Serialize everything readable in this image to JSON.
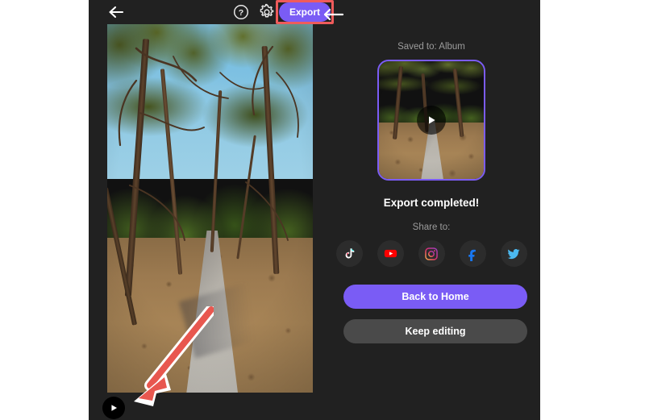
{
  "app": {
    "background_color": "#212121",
    "accent_color": "#7a5cf5",
    "highlight_color": "#ef5b5b"
  },
  "topbar": {
    "back_icon": "arrow-left-icon",
    "help_icon": "question-circle-icon",
    "settings_icon": "gear-icon",
    "export_label": "Export"
  },
  "preview": {
    "play_icon": "play-icon"
  },
  "right_panel": {
    "saved_to_label": "Saved to: Album",
    "thumbnail_play_icon": "play-icon",
    "export_completed_label": "Export completed!",
    "share_to_label": "Share to:",
    "social": [
      {
        "name": "tiktok",
        "label": "TikTok",
        "color": "#ffffff"
      },
      {
        "name": "youtube",
        "label": "YouTube",
        "color": "#ff0000"
      },
      {
        "name": "instagram",
        "label": "Instagram",
        "color": "#e1306c"
      },
      {
        "name": "facebook",
        "label": "Facebook",
        "color": "#1877f2"
      },
      {
        "name": "twitter",
        "label": "Twitter",
        "color": "#1da1f2"
      }
    ],
    "back_home_label": "Back to Home",
    "keep_editing_label": "Keep editing"
  },
  "annotations": {
    "pointer_arrow_icon": "arrow-left-annotation",
    "callout_arrow_icon": "arrow-down-left-annotation",
    "highlight_target": "Export"
  }
}
